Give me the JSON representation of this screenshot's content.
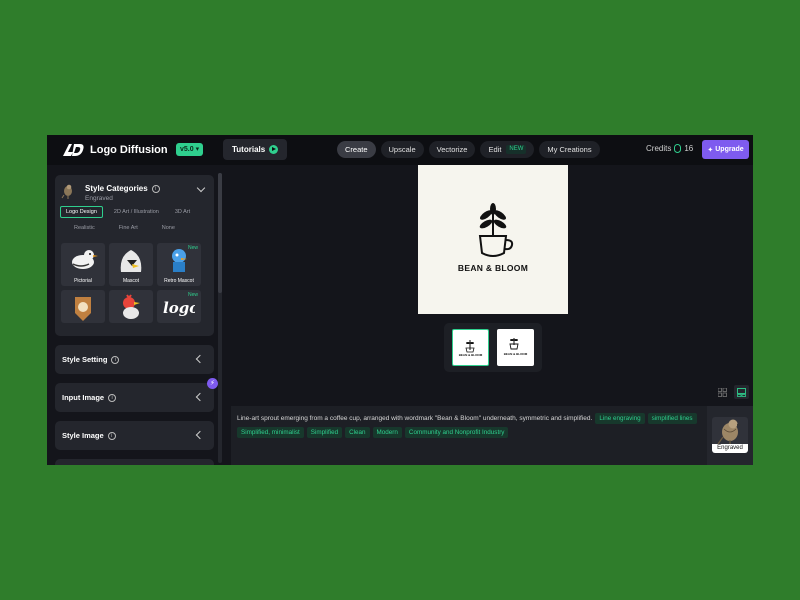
{
  "brand": {
    "name": "Logo Diffusion",
    "version": "v5.0"
  },
  "header": {
    "tutorials_label": "Tutorials",
    "nav": [
      {
        "label": "Create",
        "active": true
      },
      {
        "label": "Upscale"
      },
      {
        "label": "Vectorize"
      },
      {
        "label": "Edit",
        "badge": "NEW"
      },
      {
        "label": "My Creations"
      }
    ],
    "credits_label": "Credits",
    "credits_value": "16",
    "upgrade_label": "Upgrade"
  },
  "sidebar": {
    "style_categories": {
      "title": "Style Categories",
      "selected": "Engraved",
      "tabs_row1": [
        "Logo Design",
        "2D Art / Illustration",
        "3D Art"
      ],
      "tabs_row2": [
        "Realistic",
        "Fine Art",
        "None"
      ],
      "tiles": [
        {
          "label": "Pictorial"
        },
        {
          "label": "Mascot"
        },
        {
          "label": "Retro Mascot",
          "badge": "New"
        },
        {
          "label": ""
        },
        {
          "label": ""
        },
        {
          "label": "",
          "badge": "New"
        }
      ]
    },
    "style_setting": "Style Setting",
    "input_image": "Input Image",
    "style_image": "Style Image"
  },
  "canvas": {
    "brand_text": "BEAN & BLOOM"
  },
  "prompt": {
    "text": "Line-art sprout emerging from a coffee cup, arranged with wordmark \"Bean & Bloom\" underneath, symmetric and simplified.",
    "tags": [
      "Line engraving",
      "simplified lines",
      "Simplified, minimalist",
      "Simplified",
      "Clean",
      "Modern",
      "Community and Nonprofit Industry"
    ]
  },
  "style_preview": {
    "label": "Engraved"
  },
  "colors": {
    "accent": "#2fcf8e",
    "upgrade": "#7e5bef",
    "background": "#14151b"
  }
}
